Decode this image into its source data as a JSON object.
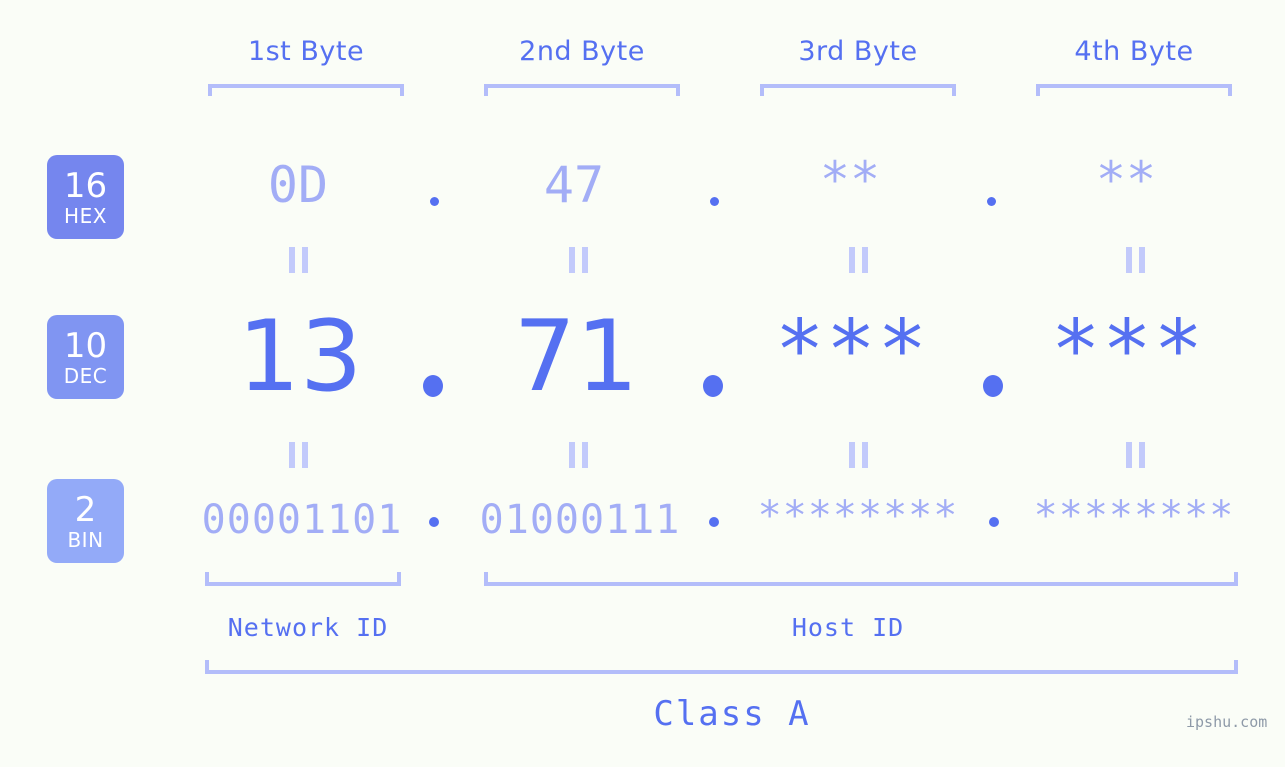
{
  "page": {
    "background_color": "#FAFDF7",
    "accent_strong": "#5570F1",
    "accent_light": "#A2ADF6",
    "bracket_color": "#B3BDFA",
    "watermark": "ipshu.com"
  },
  "byte_headers": [
    {
      "label": "1st Byte"
    },
    {
      "label": "2nd Byte"
    },
    {
      "label": "3rd Byte"
    },
    {
      "label": "4th Byte"
    }
  ],
  "rows": [
    {
      "badge_number": "16",
      "badge_name": "HEX",
      "badge_color": "#7586EE",
      "values": [
        "0D",
        "47",
        "**",
        "**"
      ],
      "separator": "."
    },
    {
      "badge_number": "10",
      "badge_name": "DEC",
      "badge_color": "#8095F2",
      "values": [
        "13",
        "71",
        "***",
        "***"
      ],
      "separator": "."
    },
    {
      "badge_number": "2",
      "badge_name": "BIN",
      "badge_color": "#93AAF8",
      "values": [
        "00001101",
        "01000111",
        "********",
        "********"
      ],
      "separator": "."
    }
  ],
  "equal_mark": "||",
  "footer": {
    "network_id_label": "Network ID",
    "host_id_label": "Host ID",
    "class_label": "Class A"
  }
}
